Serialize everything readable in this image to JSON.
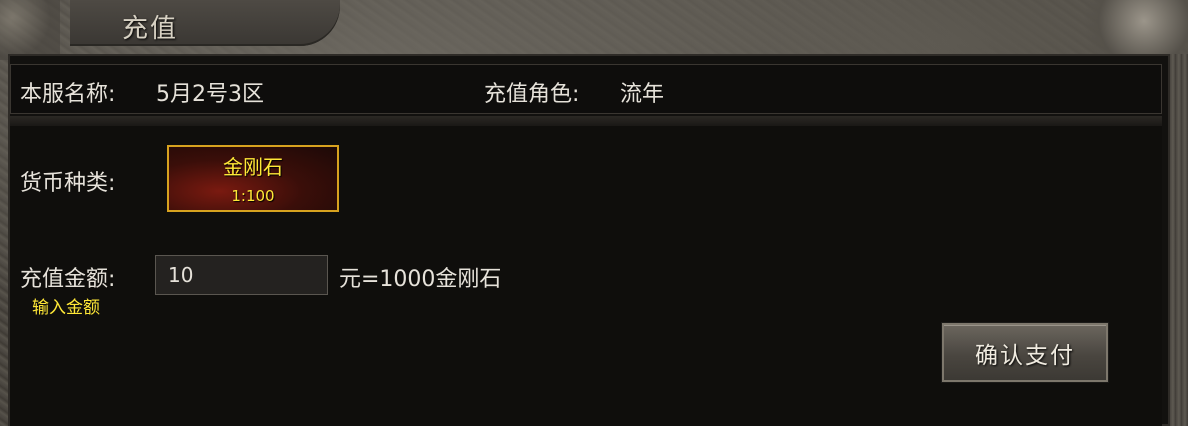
{
  "window": {
    "title": "充值"
  },
  "info": {
    "server_label": "本服名称:",
    "server_value": "5月2号3区",
    "role_label": "充值角色:",
    "role_value": "流年"
  },
  "currency": {
    "label": "货币种类:",
    "selected_name": "金刚石",
    "selected_rate": "1:100"
  },
  "amount": {
    "label": "充值金额:",
    "value": "10",
    "hint": "输入金额",
    "conversion": "元=1000金刚石"
  },
  "actions": {
    "confirm_label": "确认支付"
  },
  "colors": {
    "accent_yellow": "#ffe837",
    "card_border": "#d7a21f",
    "panel_bg": "#12110f",
    "text": "#e6e2da"
  }
}
